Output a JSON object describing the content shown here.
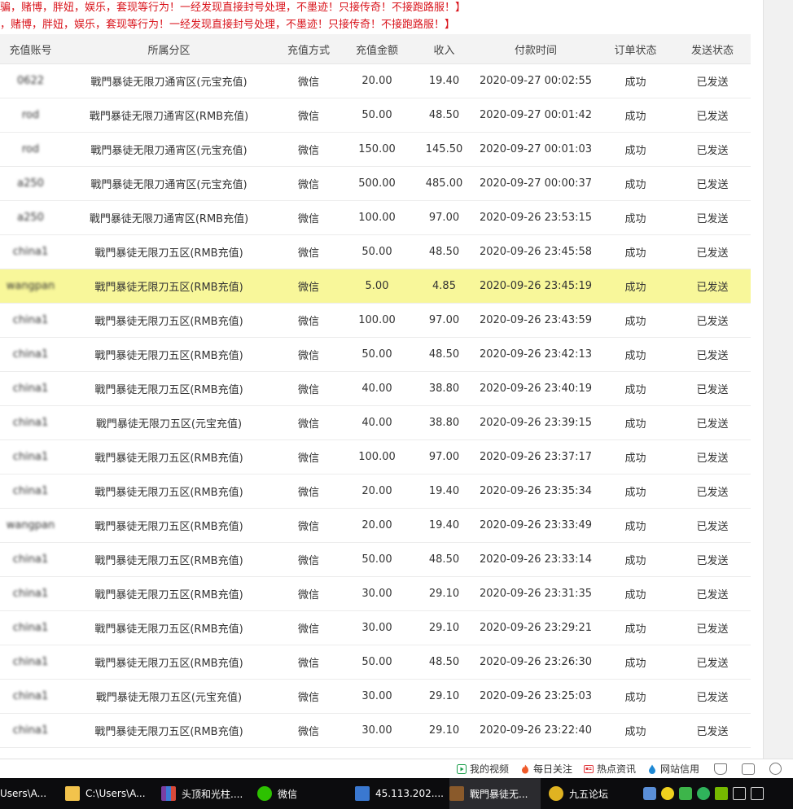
{
  "notices": [
    "骗，赌博，胖妞，娱乐，套现等行为！一经发现直接封号处理，不墨迹！只接传奇！不接跑路服！】",
    "，赌博，胖妞，娱乐，套现等行为！一经发现直接封号处理，不墨迹！只接传奇！不接跑路服！】"
  ],
  "table": {
    "headers": [
      "充值账号",
      "所属分区",
      "充值方式",
      "充值金额",
      "收入",
      "付款时间",
      "订单状态",
      "发送状态"
    ],
    "rows": [
      {
        "account": "0622",
        "zone": "戰門暴徒无限刀通宵区(元宝充值)",
        "method": "微信",
        "amount": "20.00",
        "income": "19.40",
        "time": "2020-09-27 00:02:55",
        "order_status": "成功",
        "send_status": "已发送"
      },
      {
        "account": "rod",
        "zone": "戰門暴徒无限刀通宵区(RMB充值)",
        "method": "微信",
        "amount": "50.00",
        "income": "48.50",
        "time": "2020-09-27 00:01:42",
        "order_status": "成功",
        "send_status": "已发送"
      },
      {
        "account": "rod",
        "zone": "戰門暴徒无限刀通宵区(元宝充值)",
        "method": "微信",
        "amount": "150.00",
        "income": "145.50",
        "time": "2020-09-27 00:01:03",
        "order_status": "成功",
        "send_status": "已发送"
      },
      {
        "account": "a250",
        "zone": "戰門暴徒无限刀通宵区(元宝充值)",
        "method": "微信",
        "amount": "500.00",
        "income": "485.00",
        "time": "2020-09-27 00:00:37",
        "order_status": "成功",
        "send_status": "已发送"
      },
      {
        "account": "a250",
        "zone": "戰門暴徒无限刀通宵区(RMB充值)",
        "method": "微信",
        "amount": "100.00",
        "income": "97.00",
        "time": "2020-09-26 23:53:15",
        "order_status": "成功",
        "send_status": "已发送"
      },
      {
        "account": "china1",
        "zone": "戰門暴徒无限刀五区(RMB充值)",
        "method": "微信",
        "amount": "50.00",
        "income": "48.50",
        "time": "2020-09-26 23:45:58",
        "order_status": "成功",
        "send_status": "已发送"
      },
      {
        "account": "wangpan",
        "zone": "戰門暴徒无限刀五区(RMB充值)",
        "method": "微信",
        "amount": "5.00",
        "income": "4.85",
        "time": "2020-09-26 23:45:19",
        "order_status": "成功",
        "send_status": "已发送",
        "highlight": true
      },
      {
        "account": "china1",
        "zone": "戰門暴徒无限刀五区(RMB充值)",
        "method": "微信",
        "amount": "100.00",
        "income": "97.00",
        "time": "2020-09-26 23:43:59",
        "order_status": "成功",
        "send_status": "已发送"
      },
      {
        "account": "china1",
        "zone": "戰門暴徒无限刀五区(RMB充值)",
        "method": "微信",
        "amount": "50.00",
        "income": "48.50",
        "time": "2020-09-26 23:42:13",
        "order_status": "成功",
        "send_status": "已发送"
      },
      {
        "account": "china1",
        "zone": "戰門暴徒无限刀五区(RMB充值)",
        "method": "微信",
        "amount": "40.00",
        "income": "38.80",
        "time": "2020-09-26 23:40:19",
        "order_status": "成功",
        "send_status": "已发送"
      },
      {
        "account": "china1",
        "zone": "戰門暴徒无限刀五区(元宝充值)",
        "method": "微信",
        "amount": "40.00",
        "income": "38.80",
        "time": "2020-09-26 23:39:15",
        "order_status": "成功",
        "send_status": "已发送"
      },
      {
        "account": "china1",
        "zone": "戰門暴徒无限刀五区(RMB充值)",
        "method": "微信",
        "amount": "100.00",
        "income": "97.00",
        "time": "2020-09-26 23:37:17",
        "order_status": "成功",
        "send_status": "已发送"
      },
      {
        "account": "china1",
        "zone": "戰門暴徒无限刀五区(RMB充值)",
        "method": "微信",
        "amount": "20.00",
        "income": "19.40",
        "time": "2020-09-26 23:35:34",
        "order_status": "成功",
        "send_status": "已发送"
      },
      {
        "account": "wangpan",
        "zone": "戰門暴徒无限刀五区(RMB充值)",
        "method": "微信",
        "amount": "20.00",
        "income": "19.40",
        "time": "2020-09-26 23:33:49",
        "order_status": "成功",
        "send_status": "已发送"
      },
      {
        "account": "china1",
        "zone": "戰門暴徒无限刀五区(RMB充值)",
        "method": "微信",
        "amount": "50.00",
        "income": "48.50",
        "time": "2020-09-26 23:33:14",
        "order_status": "成功",
        "send_status": "已发送"
      },
      {
        "account": "china1",
        "zone": "戰門暴徒无限刀五区(RMB充值)",
        "method": "微信",
        "amount": "30.00",
        "income": "29.10",
        "time": "2020-09-26 23:31:35",
        "order_status": "成功",
        "send_status": "已发送"
      },
      {
        "account": "china1",
        "zone": "戰門暴徒无限刀五区(RMB充值)",
        "method": "微信",
        "amount": "30.00",
        "income": "29.10",
        "time": "2020-09-26 23:29:21",
        "order_status": "成功",
        "send_status": "已发送"
      },
      {
        "account": "china1",
        "zone": "戰門暴徒无限刀五区(RMB充值)",
        "method": "微信",
        "amount": "50.00",
        "income": "48.50",
        "time": "2020-09-26 23:26:30",
        "order_status": "成功",
        "send_status": "已发送"
      },
      {
        "account": "china1",
        "zone": "戰門暴徒无限刀五区(元宝充值)",
        "method": "微信",
        "amount": "30.00",
        "income": "29.10",
        "time": "2020-09-26 23:25:03",
        "order_status": "成功",
        "send_status": "已发送"
      },
      {
        "account": "china1",
        "zone": "戰門暴徒无限刀五区(RMB充值)",
        "method": "微信",
        "amount": "30.00",
        "income": "29.10",
        "time": "2020-09-26 23:22:40",
        "order_status": "成功",
        "send_status": "已发送"
      }
    ]
  },
  "news_bar": {
    "items": [
      {
        "label": "我的视频",
        "icon": "play-icon"
      },
      {
        "label": "每日关注",
        "icon": "flame-icon"
      },
      {
        "label": "热点资讯",
        "icon": "news-icon"
      },
      {
        "label": "网站信用",
        "icon": "drop-icon"
      }
    ]
  },
  "taskbar": {
    "items": [
      {
        "label": "Users\\A...",
        "icon": "app-icon"
      },
      {
        "label": "C:\\Users\\A...",
        "icon": "folder-icon"
      },
      {
        "label": "头顶和光柱....",
        "icon": "archive-icon"
      },
      {
        "label": "微信",
        "icon": "wechat-icon"
      },
      {
        "label": "45.113.202....",
        "icon": "remote-desktop-icon"
      },
      {
        "label": "戰門暴徒无...",
        "icon": "game-icon"
      },
      {
        "label": "九五论坛",
        "icon": "forum-icon"
      }
    ]
  },
  "colors": {
    "notice": "#d9141c",
    "status_success": "#2a73b8",
    "highlight_row": "#f8f79a",
    "header_bg": "#f3f3f3",
    "taskbar_bg": "#0c0c0e"
  }
}
